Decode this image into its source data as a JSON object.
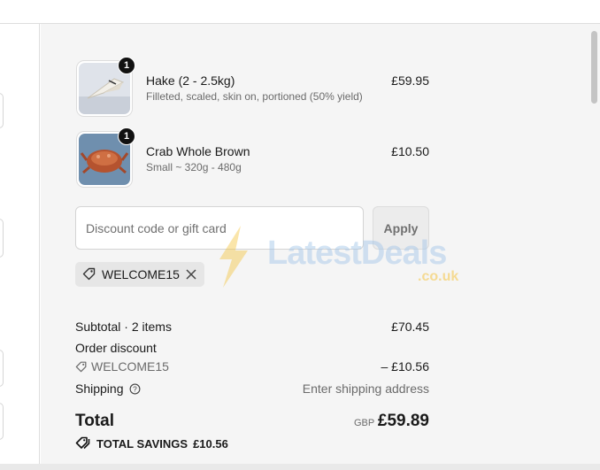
{
  "items": [
    {
      "quantity": "1",
      "name": "Hake (2 - 2.5kg)",
      "description": "Filleted, scaled, skin on, portioned (50% yield)",
      "price": "£59.95",
      "image": "fish-fillet"
    },
    {
      "quantity": "1",
      "name": "Crab Whole Brown",
      "description": "Small ~ 320g - 480g",
      "price": "£10.50",
      "image": "brown-crab"
    }
  ],
  "discount": {
    "placeholder": "Discount code or gift card",
    "apply_label": "Apply",
    "applied_code": "WELCOME15"
  },
  "summary": {
    "subtotal_label": "Subtotal · 2 items",
    "subtotal_value": "£70.45",
    "order_discount_label": "Order discount",
    "discount_code": "WELCOME15",
    "discount_value": "– £10.56",
    "shipping_label": "Shipping",
    "shipping_value": "Enter shipping address",
    "total_label": "Total",
    "currency": "GBP",
    "total_value": "£59.89",
    "savings_label": "TOTAL SAVINGS",
    "savings_value": "£10.56"
  },
  "watermark": {
    "text": "LatestDeals",
    "suffix": ".co.uk"
  },
  "colors": {
    "panel_bg": "#f5f5f5",
    "chip_bg": "#e6e6e6",
    "quantity_badge": "#111111"
  },
  "icons": [
    "tag-icon",
    "close-icon",
    "info-icon",
    "tags-icon",
    "bolt-icon"
  ]
}
